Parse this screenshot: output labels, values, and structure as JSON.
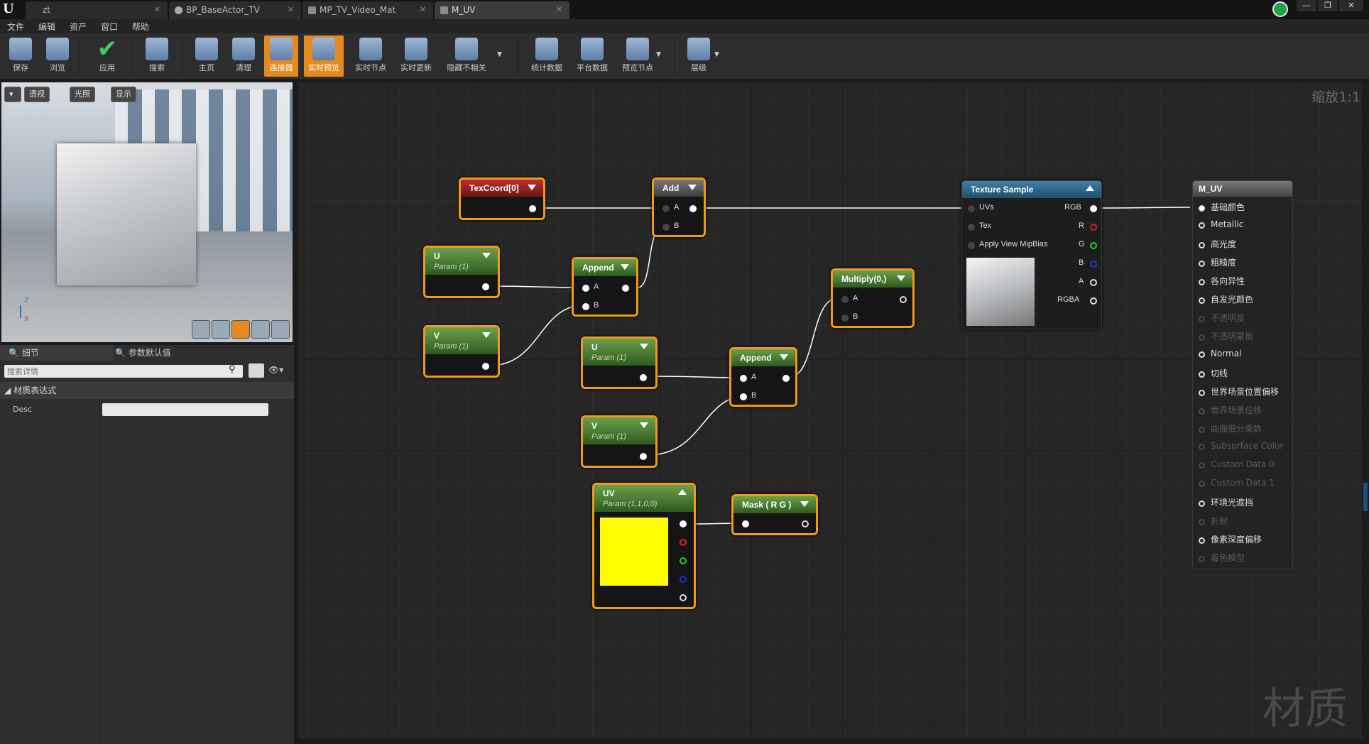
{
  "tabs": [
    {
      "label": "zt",
      "active": false
    },
    {
      "label": "BP_BaseActor_TV",
      "active": false
    },
    {
      "label": "MP_TV_Video_Mat",
      "active": false
    },
    {
      "label": "M_UV",
      "active": true
    }
  ],
  "menu": [
    "文件",
    "编辑",
    "资产",
    "窗口",
    "帮助"
  ],
  "toolbar": [
    {
      "label": "保存",
      "icon": "save-icon",
      "active": false
    },
    {
      "label": "浏览",
      "icon": "browse-icon",
      "active": false
    },
    {
      "label": "应用",
      "icon": "apply-check-icon",
      "active": false
    },
    {
      "label": "搜索",
      "icon": "search-icon",
      "active": false
    },
    {
      "label": "主页",
      "icon": "home-icon",
      "active": false
    },
    {
      "label": "清理",
      "icon": "clean-icon",
      "active": false
    },
    {
      "label": "连接器",
      "icon": "connector-icon",
      "active": true
    },
    {
      "label": "实时预览",
      "icon": "live-preview-icon",
      "active": true
    },
    {
      "label": "实时节点",
      "icon": "live-nodes-icon",
      "active": false
    },
    {
      "label": "实时更新",
      "icon": "live-update-icon",
      "active": false
    },
    {
      "label": "隐藏不相关",
      "icon": "hide-unrelated-icon",
      "active": false
    },
    {
      "label": "统计数据",
      "icon": "stats-icon",
      "active": false
    },
    {
      "label": "平台数据",
      "icon": "platform-stats-icon",
      "active": false
    },
    {
      "label": "预览节点",
      "icon": "preview-node-icon",
      "active": false
    },
    {
      "label": "层级",
      "icon": "hierarchy-icon",
      "active": false
    }
  ],
  "viewport": {
    "perspective": "透视",
    "lit": "光照",
    "show": "显示",
    "axis_z": "Z",
    "axis_x": "X"
  },
  "details": {
    "tab_details": "细节",
    "tab_params": "参数默认值",
    "search_placeholder": "搜索详情",
    "category": "材质表达式",
    "prop_desc": "Desc",
    "prop_desc_value": ""
  },
  "graph": {
    "zoom": "缩放1:1",
    "watermark": "材质"
  },
  "nodes": {
    "texcoord": {
      "title": "TexCoord[0]"
    },
    "add": {
      "title": "Add",
      "a": "A",
      "b": "B"
    },
    "u1": {
      "title": "U",
      "sub": "Param (1)"
    },
    "v1": {
      "title": "V",
      "sub": "Param (1)"
    },
    "append1": {
      "title": "Append",
      "a": "A",
      "b": "B"
    },
    "u2": {
      "title": "U",
      "sub": "Param (1)"
    },
    "v2": {
      "title": "V",
      "sub": "Param (1)"
    },
    "append2": {
      "title": "Append",
      "a": "A",
      "b": "B"
    },
    "multiply": {
      "title": "Multiply(0,)",
      "a": "A",
      "b": "B"
    },
    "uvparam": {
      "title": "UV",
      "sub": "Param (1,1,0,0)",
      "color": "#ffff00"
    },
    "mask": {
      "title": "Mask ( R G )"
    },
    "texsample": {
      "title": "Texture Sample",
      "uvs": "UVs",
      "tex": "Tex",
      "mip": "Apply View MipBias",
      "rgb": "RGB",
      "r": "R",
      "g": "G",
      "b": "B",
      "a": "A",
      "rgba": "RGBA"
    }
  },
  "result": {
    "title": "M_UV",
    "pins": [
      {
        "label": "基础颜色",
        "enabled": true,
        "connected": true
      },
      {
        "label": "Metallic",
        "enabled": true,
        "connected": false
      },
      {
        "label": "高光度",
        "enabled": true,
        "connected": false
      },
      {
        "label": "粗糙度",
        "enabled": true,
        "connected": false
      },
      {
        "label": "各向异性",
        "enabled": true,
        "connected": false
      },
      {
        "label": "自发光颜色",
        "enabled": true,
        "connected": false
      },
      {
        "label": "不透明度",
        "enabled": false,
        "connected": false
      },
      {
        "label": "不透明蒙板",
        "enabled": false,
        "connected": false
      },
      {
        "label": "Normal",
        "enabled": true,
        "connected": false
      },
      {
        "label": "切线",
        "enabled": true,
        "connected": false
      },
      {
        "label": "世界场景位置偏移",
        "enabled": true,
        "connected": false
      },
      {
        "label": "世界场景位移",
        "enabled": false,
        "connected": false
      },
      {
        "label": "曲面细分乘数",
        "enabled": false,
        "connected": false
      },
      {
        "label": "Subsurface Color",
        "enabled": false,
        "connected": false
      },
      {
        "label": "Custom Data 0",
        "enabled": false,
        "connected": false
      },
      {
        "label": "Custom Data 1",
        "enabled": false,
        "connected": false
      },
      {
        "label": "环境光遮挡",
        "enabled": true,
        "connected": false
      },
      {
        "label": "折射",
        "enabled": false,
        "connected": false
      },
      {
        "label": "像素深度偏移",
        "enabled": true,
        "connected": false
      },
      {
        "label": "着色模型",
        "enabled": false,
        "connected": false
      }
    ]
  }
}
